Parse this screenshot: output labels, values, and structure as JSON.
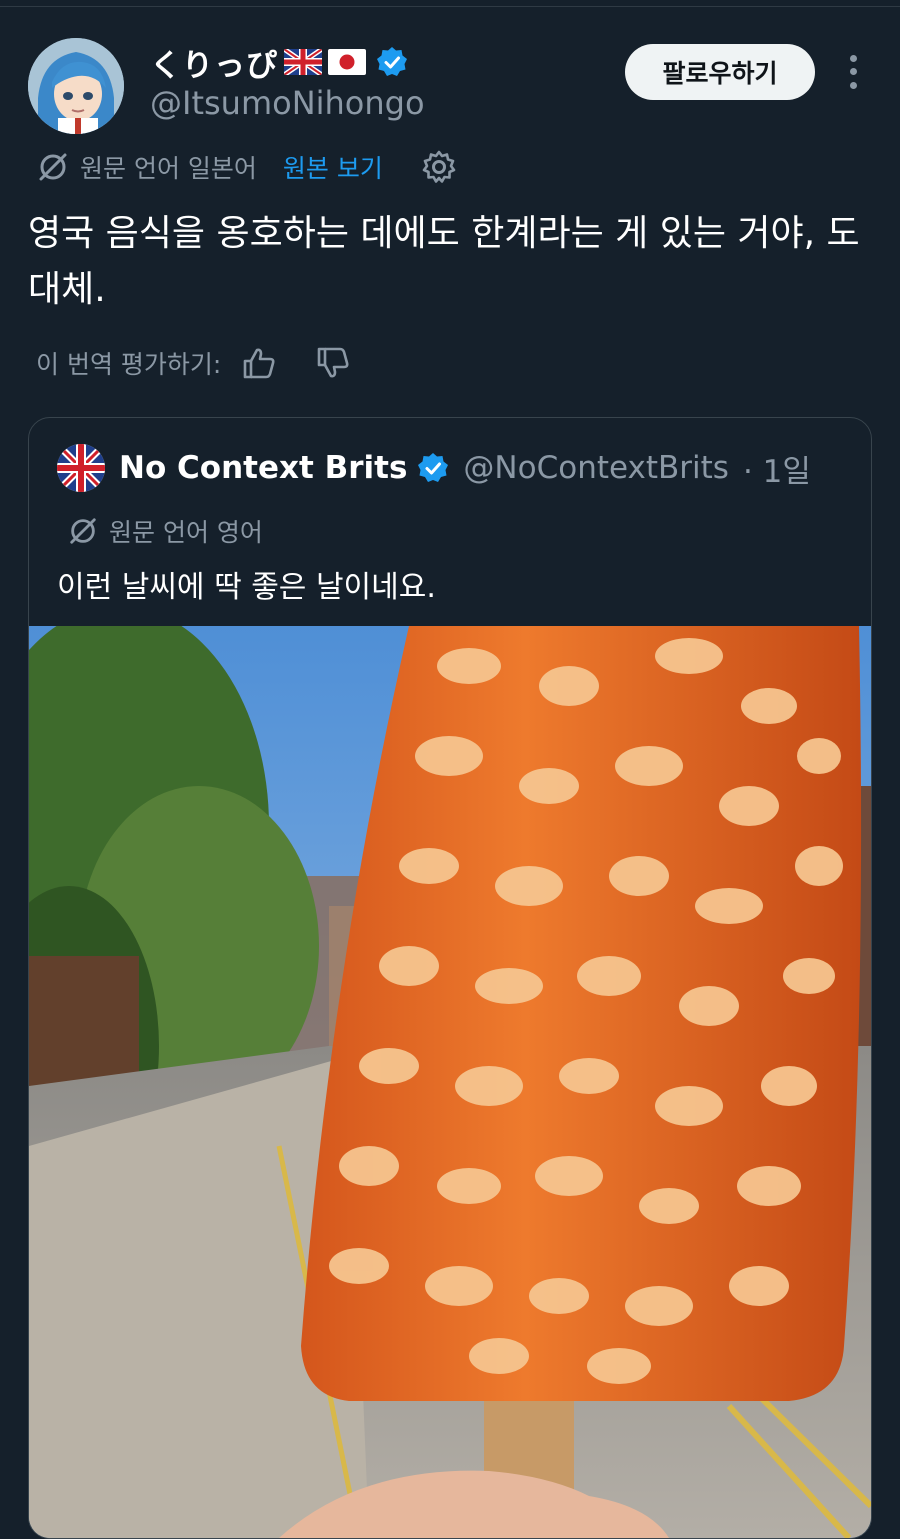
{
  "tweet": {
    "display_name": "くりっぴ",
    "handle": "@ItsumoNihongo",
    "follow_label": "팔로우하기",
    "original_language": "원문 언어 일본어",
    "view_original": "원본 보기",
    "text": "영국 음식을 옹호하는 데에도 한계라는 게 있는 거야, 도대체.",
    "rate_label": "이 번역 평가하기:",
    "icons": [
      "flag-uk-icon",
      "flag-japan-icon",
      "verified-badge-icon",
      "more-options-icon",
      "translate-icon",
      "settings-gear-icon",
      "thumbs-up-icon",
      "thumbs-down-icon"
    ]
  },
  "quoted_tweet": {
    "display_name": "No Context Brits",
    "handle": "@NoContextBrits",
    "time": "· 1일",
    "original_language": "원문 언어 영어",
    "text": "이런 날씨에 딱 좋은 날이네요.",
    "image_description_icon": "baked-beans-popsicle-photo"
  },
  "colors": {
    "background": "#15202b",
    "text_primary": "#e7e9ea",
    "text_secondary": "#8b98a5",
    "link": "#1d9bf0",
    "verified": "#1d9bf0",
    "border": "#38444d",
    "follow_button_bg": "#eff3f4"
  }
}
